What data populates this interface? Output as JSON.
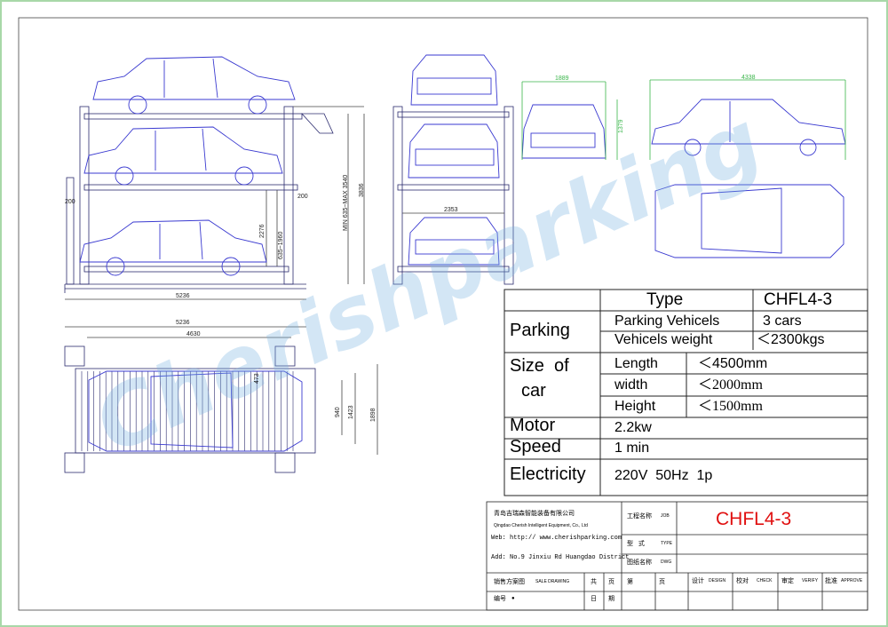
{
  "watermark": "Cherishparking",
  "spec_table": {
    "header": {
      "label": "Type",
      "value": "CHFL4-3"
    },
    "parking": {
      "label": "Parking",
      "rows": [
        {
          "name": "Parking Vehicels",
          "value": "3 cars"
        },
        {
          "name": "Vehicels weight",
          "value": "＜2300kgs"
        }
      ]
    },
    "size": {
      "label_line1": "Size  of",
      "label_line2": "car",
      "rows": [
        {
          "name": "Length",
          "value": "＜4500mm"
        },
        {
          "name": "width",
          "value": "＜2000mm"
        },
        {
          "name": "Height",
          "value": "＜1500mm"
        }
      ]
    },
    "motor": {
      "label": "Motor",
      "value": "2.2kw"
    },
    "speed": {
      "label": "Speed",
      "value": "1 min"
    },
    "electricity": {
      "label": "Electricity",
      "value": "220V  50Hz  1p"
    }
  },
  "title_block": {
    "company_cn": "青岛吉瑞森智能装备有限公司",
    "company_en": "Qingdao Cherish Intelligent Equipment, Co., Ltd",
    "web": "Web: http:// www.cherishparking.com",
    "address": "Add: No.9 Jinxiu Rd Huangdao District",
    "job_cn": "工程名称",
    "job_en": "JOB",
    "job_value": "CHFL4-3",
    "type_cn": "型   式",
    "type_en": "TYPE",
    "dwg_cn": "图纸名称",
    "dwg_en": "DWG",
    "sale_cn": "销售方案图",
    "sale_en": "SALE DRAWING",
    "total_cn": "共",
    "pages_cn": "页",
    "no_cn": "第",
    "page2_cn": "页",
    "design_cn": "设计",
    "design_en": "DESIGN",
    "check_cn": "校对",
    "check_en": "CHECK",
    "verify_cn": "审定",
    "verify_en": "VERIFY",
    "approve_cn": "批准",
    "approve_en": "APPROVE",
    "number_cn": "编号",
    "number_mark": "●",
    "date_cn": "日",
    "date2_cn": "期"
  },
  "dimensions": {
    "side_total_length": "5236",
    "side_col_offset_left": "200",
    "side_col_offset_right": "200",
    "side_level_range": "635~1960",
    "side_level_2276": "2276",
    "side_min_max": "MIN 635~MAX 3540",
    "side_total_height": "3836",
    "front_width": "2353",
    "plan_total_length": "5236",
    "plan_post_spacing": "4630",
    "plan_offset_473": "473",
    "plan_940": "940",
    "plan_1423": "1423",
    "plan_1898": "1898",
    "car_width": "1889",
    "car_height": "1379",
    "car_length": "4338"
  }
}
